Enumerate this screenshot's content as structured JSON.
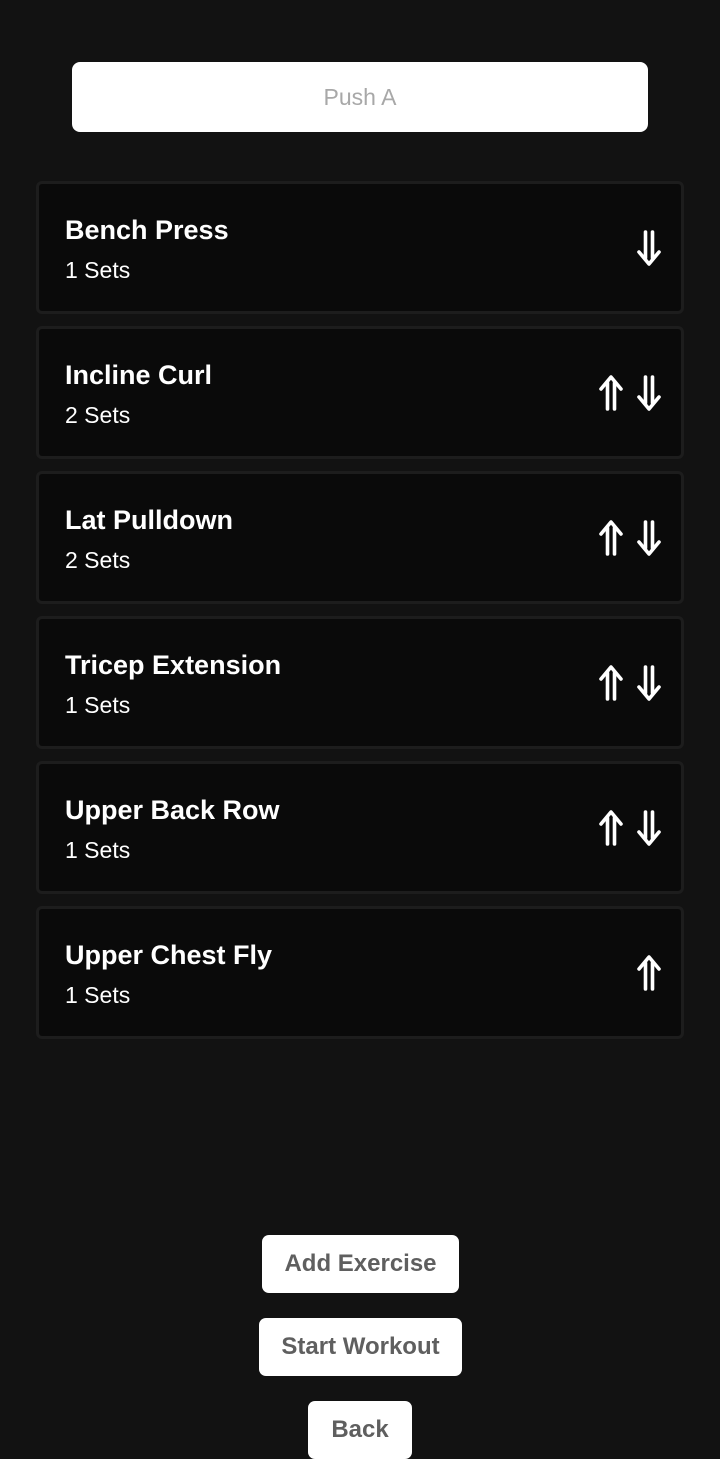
{
  "workout": {
    "name_value": "",
    "name_placeholder": "Push A"
  },
  "exercises": [
    {
      "name": "Bench Press",
      "sets": "1 Sets",
      "move_up": false,
      "move_down": true
    },
    {
      "name": "Incline Curl",
      "sets": "2 Sets",
      "move_up": true,
      "move_down": true
    },
    {
      "name": "Lat Pulldown",
      "sets": "2 Sets",
      "move_up": true,
      "move_down": true
    },
    {
      "name": "Tricep Extension",
      "sets": "1 Sets",
      "move_up": true,
      "move_down": true
    },
    {
      "name": "Upper Back Row",
      "sets": "1 Sets",
      "move_up": true,
      "move_down": true
    },
    {
      "name": "Upper Chest Fly",
      "sets": "1 Sets",
      "move_up": true,
      "move_down": false
    }
  ],
  "icons": {
    "move_up": "double-arrow-up-icon",
    "move_down": "double-arrow-down-icon"
  },
  "actions": {
    "add_exercise": "Add Exercise",
    "start_workout": "Start Workout",
    "back": "Back"
  },
  "colors": {
    "background": "#121212",
    "card_background": "#0a0a0a",
    "card_border": "#1d1d1d",
    "button_background": "#ffffff",
    "button_text": "#5f5f5f",
    "placeholder_text": "#a8a8a8"
  }
}
